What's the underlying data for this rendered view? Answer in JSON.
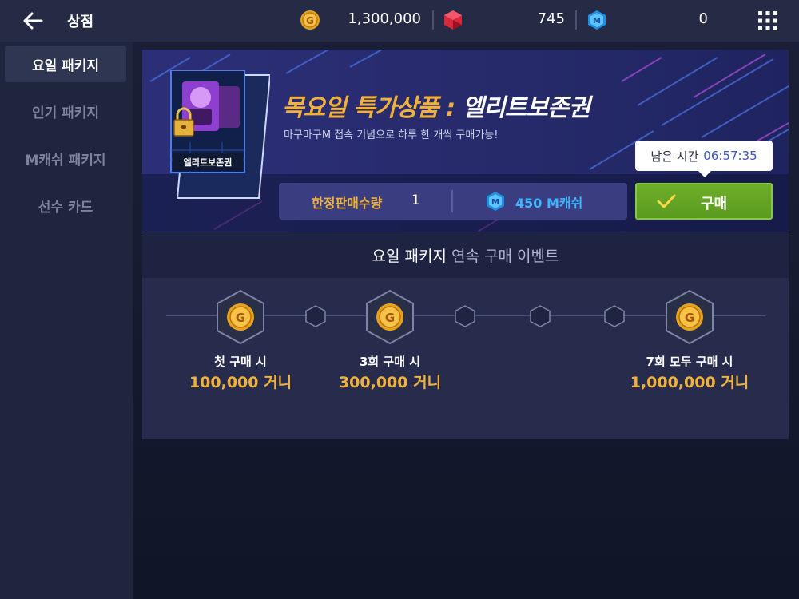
{
  "header": {
    "title": "상점",
    "gold": "1,300,000",
    "gems": "745",
    "mcash": "0"
  },
  "sidebar": {
    "items": [
      {
        "label": "요일 패키지"
      },
      {
        "label": "인기 패키지"
      },
      {
        "label": "M캐쉬 패키지"
      },
      {
        "label": "선수 카드"
      }
    ]
  },
  "promo": {
    "card_label": "엘리트보존권",
    "title_gold": "목요일 특가상품 : ",
    "title_white": "엘리트보존권",
    "subtitle": "마구마구M 접속 기념으로 하루 한 개씩 구매가능!",
    "limit_label": "한정판매수량",
    "limit_count": "1",
    "price": "450 M캐쉬",
    "timer_label": "남은 시간",
    "timer_value": "06:57:35",
    "buy_label": "구매"
  },
  "event": {
    "title_main": "요일 패키지",
    "title_sub": "연속 구매 이벤트",
    "rewards": [
      {
        "label": "첫 구매 시",
        "value": "100,000 거니"
      },
      {
        "label": "3회 구매 시",
        "value": "300,000 거니"
      },
      {
        "label": "7회 모두 구매 시",
        "value": "1,000,000 거니"
      }
    ]
  },
  "colors": {
    "accent_gold": "#f2b23a",
    "accent_blue": "#3fb6ff",
    "buy_green": "#5a9a1f"
  }
}
